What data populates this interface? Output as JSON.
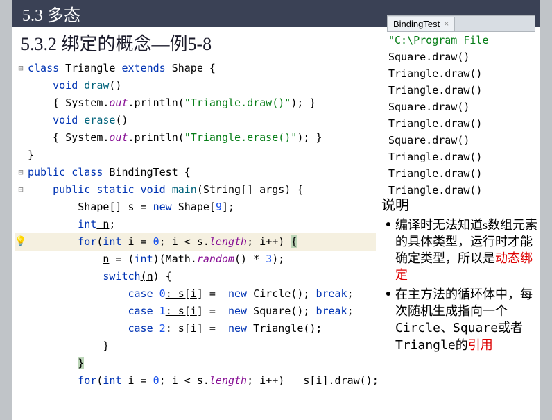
{
  "header": {
    "section": "5.3 多态",
    "subtitle": "5.3.2 绑定的概念—例5-8"
  },
  "code": {
    "l1_kw_class": "class",
    "l1_type": " Triangle ",
    "l1_kw_ext": "extends",
    "l1_super": " Shape {",
    "l2_kw_void": "void",
    "l2_method": " draw",
    "l2_rest": "()",
    "l3_a": "{ System.",
    "l3_field": "out",
    "l3_b": ".println(",
    "l3_str": "\"Triangle.draw()\"",
    "l3_c": "); }",
    "l4_kw_void": "void",
    "l4_method": " erase",
    "l4_rest": "()",
    "l5_a": "{ System.",
    "l5_field": "out",
    "l5_b": ".println(",
    "l5_str": "\"Triangle.erase()\"",
    "l5_c": "); }",
    "l6": "}",
    "l7_kw_pub": "public class",
    "l7_type": " BindingTest {",
    "l8_kw": "public static void",
    "l8_method": " main",
    "l8_rest": "(String[] args) {",
    "l9_a": "Shape[] s = ",
    "l9_kw_new": "new",
    "l9_b": " Shape[",
    "l9_num": "9",
    "l9_c": "];",
    "l10_kw_int": "int",
    "l10_var": " n",
    "l10_semi": ";",
    "l11_kw_for": "for",
    "l11_a": "(",
    "l11_kw_int": "int",
    "l11_b": " i",
    "l11_c": " = ",
    "l11_num0": "0",
    "l11_d": "; i",
    "l11_e": " < s.",
    "l11_fld": "length",
    "l11_f": "; i",
    "l11_g": "++) ",
    "l11_brace": "{",
    "l12_a": "n",
    "l12_b": " = (",
    "l12_kw_int": "int",
    "l12_c": ")(Math.",
    "l12_method": "random",
    "l12_d": "() * ",
    "l12_num": "3",
    "l12_e": ");",
    "l13_kw_switch": "switch",
    "l13_a": "(n",
    "l13_b": ") {",
    "l14_kw_case": "case",
    "l14_num": " 0",
    "l14_a": ": s[i",
    "l14_b": "] =  ",
    "l14_kw_new": "new",
    "l14_c": " Circle(); ",
    "l14_kw_break": "break",
    "l14_d": ";",
    "l15_kw_case": "case",
    "l15_num": " 1",
    "l15_a": ": s[i",
    "l15_b": "] =  ",
    "l15_kw_new": "new",
    "l15_c": " Square(); ",
    "l15_kw_break": "break",
    "l15_d": ";",
    "l16_kw_case": "case",
    "l16_num": " 2",
    "l16_a": ": s[i",
    "l16_b": "] =  ",
    "l16_kw_new": "new",
    "l16_c": " Triangle();",
    "l17": "}",
    "l18": "}",
    "l19_kw_for": "for",
    "l19_a": "(",
    "l19_kw_int": "int",
    "l19_b": " i",
    "l19_c": " = ",
    "l19_num0": "0",
    "l19_d": "; i",
    "l19_e": " < s.",
    "l19_fld": "length",
    "l19_f": "; i",
    "l19_g": "++)   s[i",
    "l19_h": "].draw();"
  },
  "tab": {
    "name": "BindingTest",
    "close": "×"
  },
  "console": {
    "path": "\"C:\\Program File",
    "lines": [
      "Square.draw()",
      "Triangle.draw()",
      "Triangle.draw()",
      "Square.draw()",
      "Triangle.draw()",
      "Square.draw()",
      "Triangle.draw()",
      "Triangle.draw()",
      "Triangle.draw()"
    ]
  },
  "explain": {
    "title": "说明",
    "b1_p1": "编译时无法知道s数组元素的具体类型，运行时才能确定类型，所以是",
    "b1_red": "动态绑定",
    "b2_p1": "在主方法的循环体中，每次随机生成指向一个",
    "b2_mono": "Circle、Square",
    "b2_p2": "或者",
    "b2_mono2": "Triangle",
    "b2_p3": "的",
    "b2_red": "引用"
  }
}
